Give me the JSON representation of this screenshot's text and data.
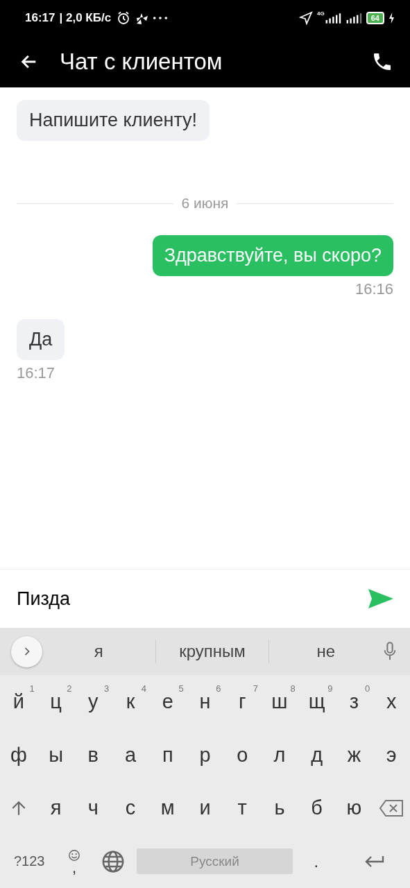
{
  "status_bar": {
    "time": "16:17",
    "speed": "| 2,0 КБ/с",
    "network": "4G",
    "battery": "64"
  },
  "header": {
    "title": "Чат с клиентом"
  },
  "messages": [
    {
      "kind": "incoming",
      "text": "Напишите клиенту!"
    },
    {
      "kind": "date",
      "text": "6 июня"
    },
    {
      "kind": "outgoing",
      "text": "Здравствуйте, вы скоро?",
      "time": "16:16"
    },
    {
      "kind": "incoming",
      "text": "Да",
      "time": "16:17"
    }
  ],
  "composer": {
    "value": "Пизда"
  },
  "keyboard": {
    "suggestions": [
      "я",
      "крупным",
      "не"
    ],
    "rows": [
      [
        {
          "key": "й",
          "hint": "1"
        },
        {
          "key": "ц",
          "hint": "2"
        },
        {
          "key": "у",
          "hint": "3"
        },
        {
          "key": "к",
          "hint": "4"
        },
        {
          "key": "е",
          "hint": "5"
        },
        {
          "key": "н",
          "hint": "6"
        },
        {
          "key": "г",
          "hint": "7"
        },
        {
          "key": "ш",
          "hint": "8"
        },
        {
          "key": "щ",
          "hint": "9"
        },
        {
          "key": "з",
          "hint": "0"
        },
        {
          "key": "х"
        }
      ],
      [
        {
          "key": "ф"
        },
        {
          "key": "ы"
        },
        {
          "key": "в"
        },
        {
          "key": "а"
        },
        {
          "key": "п"
        },
        {
          "key": "р"
        },
        {
          "key": "о"
        },
        {
          "key": "л"
        },
        {
          "key": "д"
        },
        {
          "key": "ж"
        },
        {
          "key": "э"
        }
      ],
      [
        {
          "kind": "shift"
        },
        {
          "kind": "letter",
          "key": "я"
        },
        {
          "kind": "letter",
          "key": "ч"
        },
        {
          "kind": "letter",
          "key": "с"
        },
        {
          "kind": "letter",
          "key": "м"
        },
        {
          "kind": "letter",
          "key": "и"
        },
        {
          "kind": "letter",
          "key": "т"
        },
        {
          "kind": "letter",
          "key": "ь"
        },
        {
          "kind": "letter",
          "key": "б"
        },
        {
          "kind": "letter",
          "key": "ю"
        },
        {
          "kind": "backspace"
        }
      ]
    ],
    "symbols": "?123",
    "comma": ",",
    "space": "Русский",
    "period": "."
  }
}
